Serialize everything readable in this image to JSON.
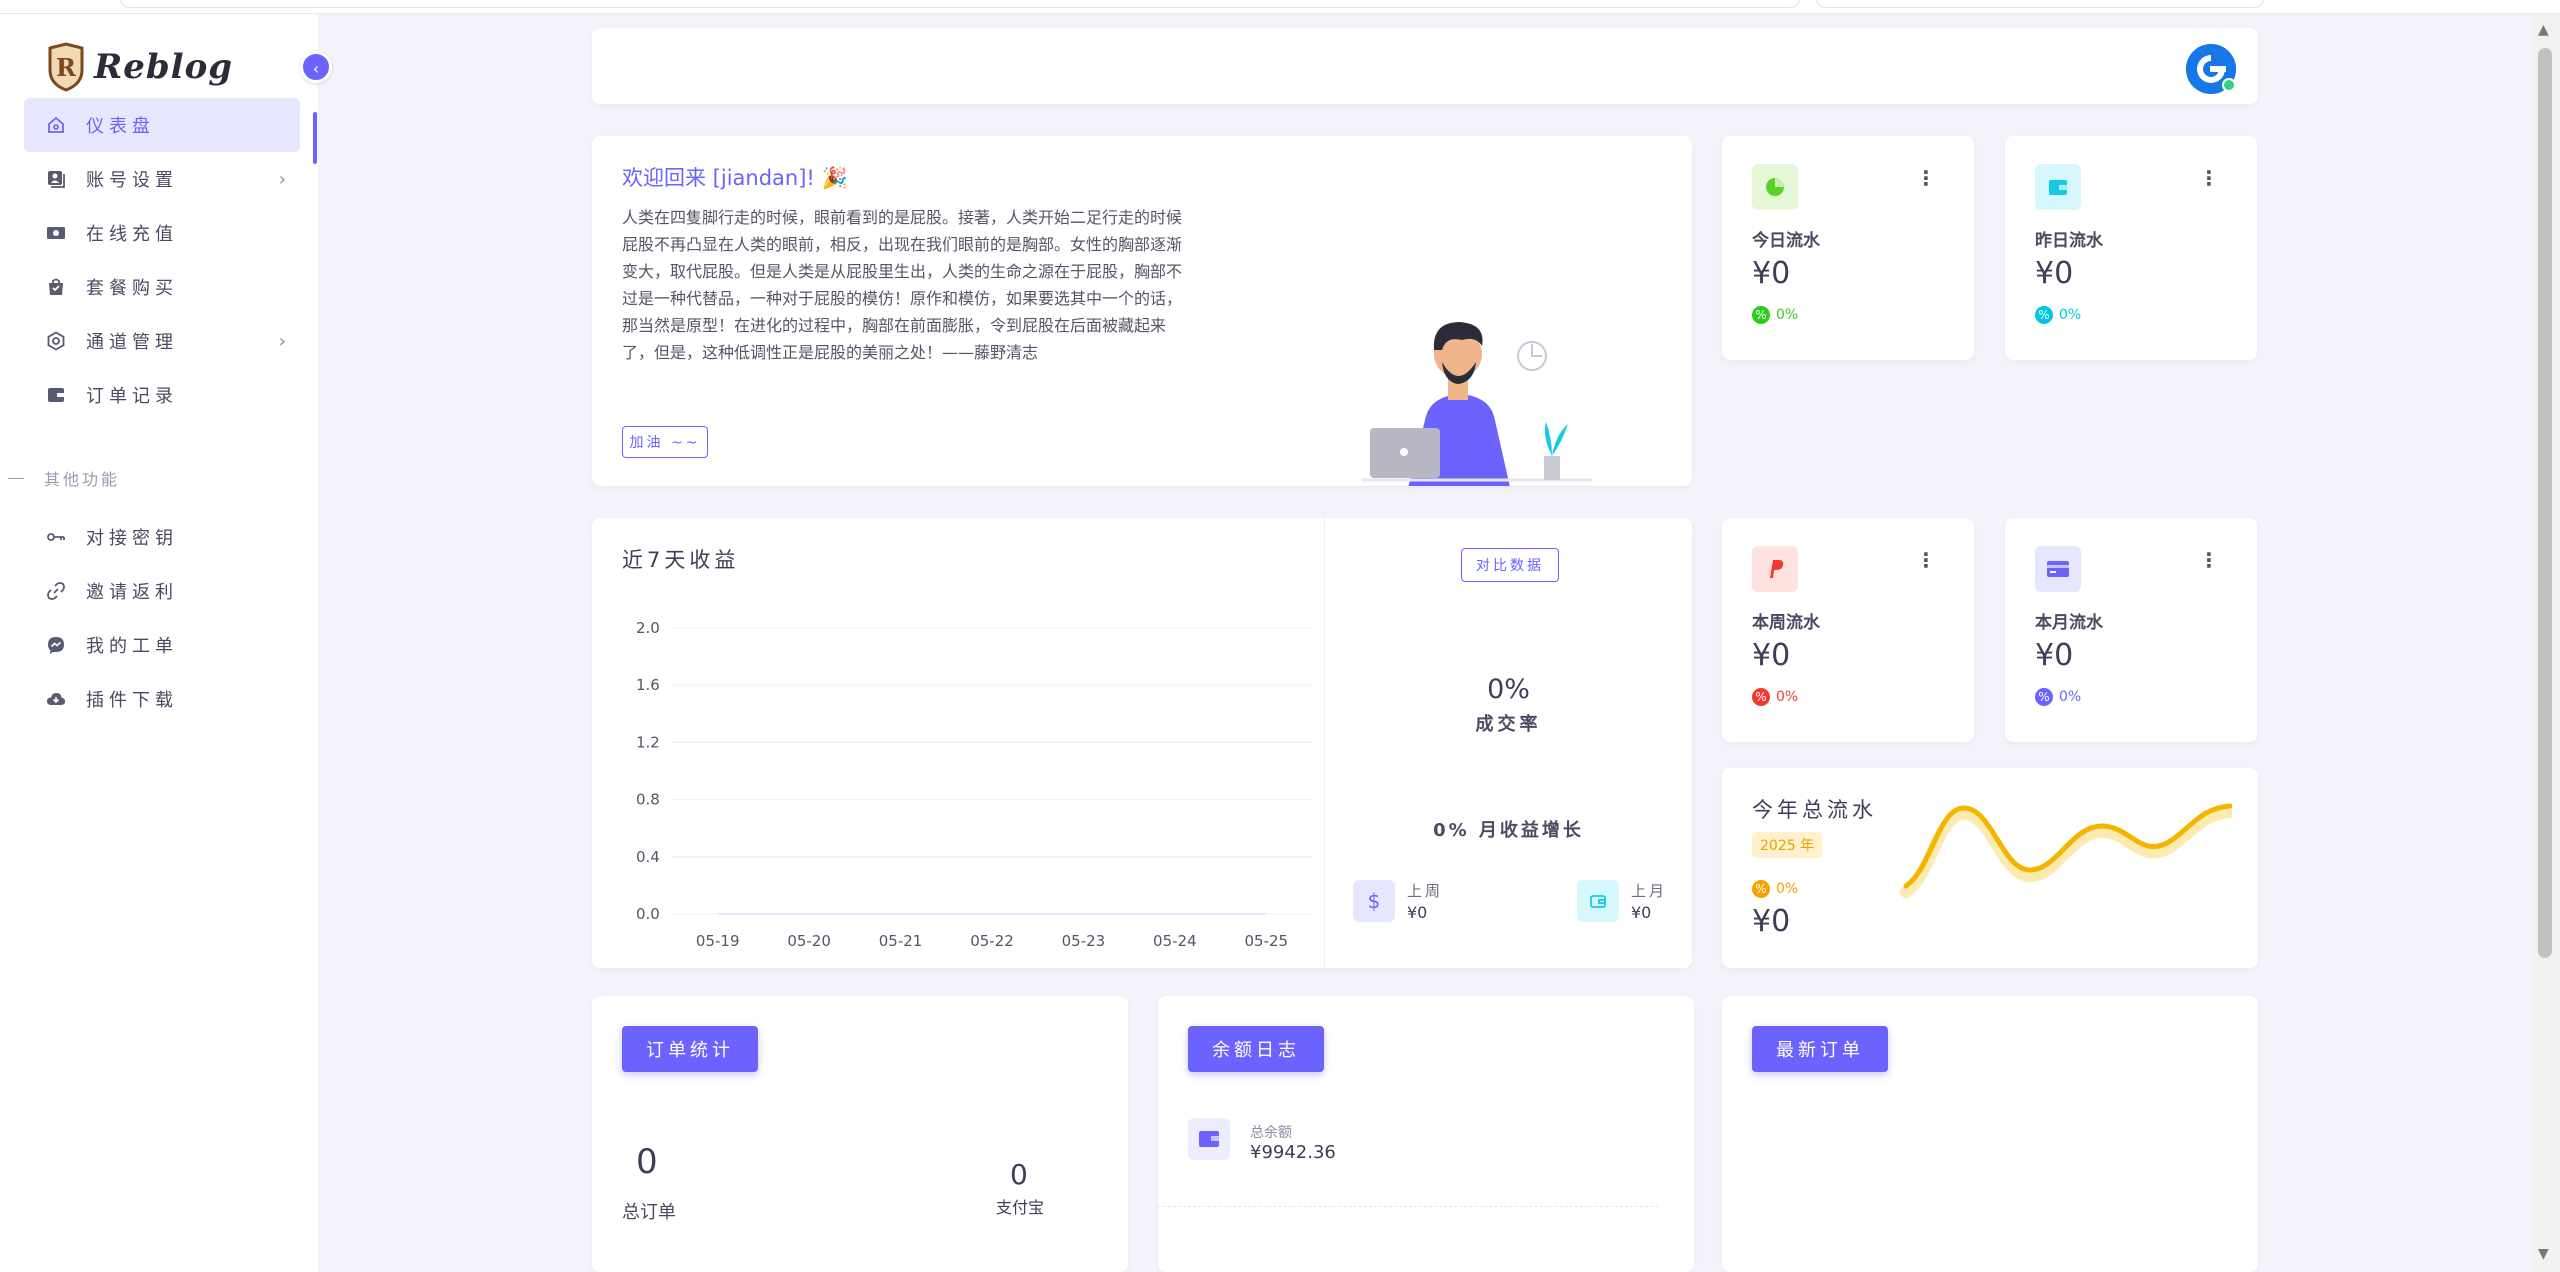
{
  "app": {
    "brand": "Reblog"
  },
  "sidebar": {
    "items": [
      {
        "label": "仪表盘",
        "icon": "home-icon",
        "active": true
      },
      {
        "label": "账号设置",
        "icon": "account-icon",
        "expandable": true
      },
      {
        "label": "在线充值",
        "icon": "money-icon"
      },
      {
        "label": "套餐购买",
        "icon": "shopping-bag-icon"
      },
      {
        "label": "通道管理",
        "icon": "gear-icon",
        "expandable": true
      },
      {
        "label": "订单记录",
        "icon": "wallet-icon"
      }
    ],
    "section_title": "其他功能",
    "other_items": [
      {
        "label": "对接密钥",
        "icon": "key-icon"
      },
      {
        "label": "邀请返利",
        "icon": "link-icon"
      },
      {
        "label": "我的工单",
        "icon": "messenger-icon"
      },
      {
        "label": "插件下载",
        "icon": "cloud-download-icon"
      }
    ]
  },
  "welcome": {
    "title": "欢迎回来 [jiandan]! 🎉",
    "text": "人类在四隻脚行走的时候，眼前看到的是屁股。接著，人类开始二足行走的时候屁股不再凸显在人类的眼前，相反，出现在我们眼前的是胸部。女性的胸部逐渐变大，取代屁股。但是人类是从屁股里生出，人类的生命之源在于屁股，胸部不过是一种代替品，一种对于屁股的模仿！原作和模仿，如果要选其中一个的话，那当然是原型！在进化的过程中，胸部在前面膨胀，令到屁股在后面被藏起来了，但是，这种低调性正是屁股的美丽之处！——藤野清志",
    "button": "加油 ~~"
  },
  "stats": {
    "today": {
      "label": "今日流水",
      "value": "¥0",
      "trend": "0%",
      "color": "#2ecc1a",
      "icon": "pie-chart-icon"
    },
    "yesterday": {
      "label": "昨日流水",
      "value": "¥0",
      "trend": "0%",
      "color": "#00c8e0",
      "icon": "wallet-icon"
    },
    "week": {
      "label": "本周流水",
      "value": "¥0",
      "trend": "0%",
      "color": "#ef3b2c",
      "icon": "paypal-icon"
    },
    "month": {
      "label": "本月流水",
      "value": "¥0",
      "trend": "0%",
      "color": "#6c63ff",
      "icon": "credit-card-icon"
    }
  },
  "revenue": {
    "title": "近7天收益",
    "compare_button": "对比数据",
    "rate_value": "0%",
    "rate_label": "成交率",
    "growth": "0% 月收益增长",
    "last_week_label": "上周",
    "last_week_value": "¥0",
    "last_month_label": "上月",
    "last_month_value": "¥0"
  },
  "chart_data": {
    "type": "line",
    "categories": [
      "05-19",
      "05-20",
      "05-21",
      "05-22",
      "05-23",
      "05-24",
      "05-25"
    ],
    "values": [
      0,
      0,
      0,
      0,
      0,
      0,
      0
    ],
    "title": "近7天收益",
    "xlabel": "",
    "ylabel": "",
    "ylim": [
      0,
      2.0
    ],
    "yticks": [
      "0.0",
      "0.4",
      "0.8",
      "1.2",
      "1.6",
      "2.0"
    ],
    "grid": true
  },
  "yearly": {
    "title": "今年总流水",
    "badge": "2025 年",
    "trend": "0%",
    "value": "¥0",
    "color": "#f5b400"
  },
  "orders": {
    "button": "订单统计",
    "total_value": "0",
    "total_label": "总订单",
    "alipay_value": "0",
    "alipay_label": "支付宝"
  },
  "balance": {
    "button": "余额日志",
    "label": "总余额",
    "value": "¥9942.36"
  },
  "latest_orders": {
    "button": "最新订单"
  },
  "colors": {
    "accent": "#6c63ff",
    "background": "#f4f3fb"
  }
}
